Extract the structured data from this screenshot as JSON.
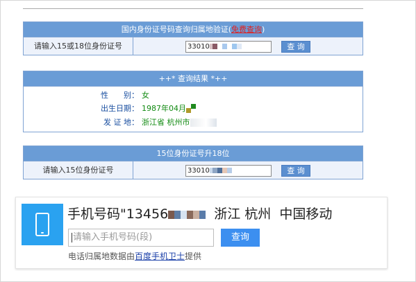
{
  "id_query": {
    "title": "国内身份证号码查询归属地验证",
    "free_query": "免费查询",
    "input_label": "请输入15或18位身份证号",
    "input_value": "33010",
    "search_button": "查 询"
  },
  "result": {
    "title": "++* 查询结果 *++",
    "gender_key": "性　　别：",
    "gender_value": "女",
    "birth_key": "出生日期：",
    "birth_value": "1987年04月",
    "origin_key": "发 证 地：",
    "origin_value": "浙江省 杭州市"
  },
  "upgrade": {
    "title": "15位身份证号升18位",
    "input_label": "请输入15位身份证号",
    "input_value": "33010",
    "search_button": "查 询"
  },
  "phone": {
    "title_prefix": "手机号码\"13456",
    "province": "浙江",
    "city": "杭州",
    "carrier": "中国移动",
    "input_placeholder": "请输入手机号码(段)",
    "search_button": "查询",
    "source_prefix": "电话归属地数据由",
    "source_link": "百度手机卫士",
    "source_suffix": "提供"
  },
  "colors": {
    "panel_header": "#6a9cd6",
    "panel_border": "#7fa3d3",
    "row_background": "#edf2fb",
    "result_key": "#1a4fa0",
    "result_value": "#118a11",
    "free_query_link": "#e02020",
    "phone_icon_background": "#2aa2f0",
    "phone_button": "#3c8ff0",
    "source_link": "#1a3fa8"
  },
  "icons": {
    "phone_card": "mobile-phone-icon"
  }
}
